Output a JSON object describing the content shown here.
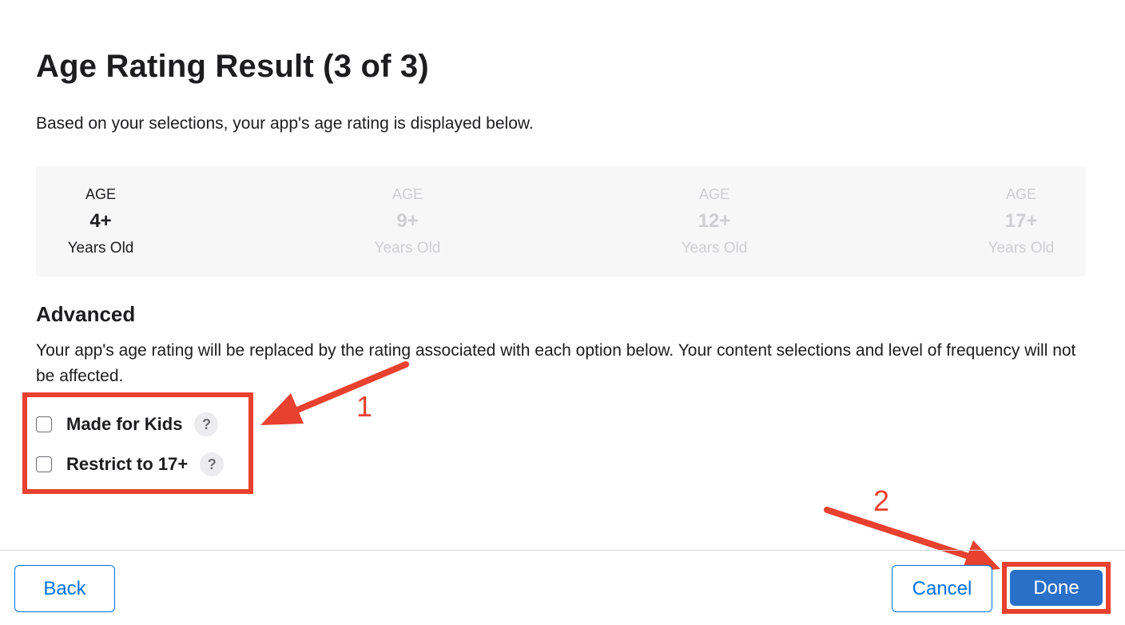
{
  "header": {
    "title": "Age Rating Result (3 of 3)",
    "subtitle": "Based on your selections, your app's age rating is displayed below."
  },
  "ratings": [
    {
      "age_label": "AGE",
      "value": "4+",
      "unit": "Years Old",
      "selected": true
    },
    {
      "age_label": "AGE",
      "value": "9+",
      "unit": "Years Old",
      "selected": false
    },
    {
      "age_label": "AGE",
      "value": "12+",
      "unit": "Years Old",
      "selected": false
    },
    {
      "age_label": "AGE",
      "value": "17+",
      "unit": "Years Old",
      "selected": false
    }
  ],
  "advanced": {
    "heading": "Advanced",
    "description": "Your app's age rating will be replaced by the rating associated with each option below. Your content selections and level of frequency will not be affected.",
    "options": [
      {
        "label": "Made for Kids",
        "checked": false,
        "help": "?"
      },
      {
        "label": "Restrict to 17+",
        "checked": false,
        "help": "?"
      }
    ]
  },
  "annotations": {
    "step1": "1",
    "step2": "2",
    "color": "#e8412f"
  },
  "footer": {
    "back_label": "Back",
    "cancel_label": "Cancel",
    "done_label": "Done"
  },
  "colors": {
    "primary": "#2a70c9",
    "link": "#0071e3",
    "inactive_text": "#cfcfd2"
  }
}
